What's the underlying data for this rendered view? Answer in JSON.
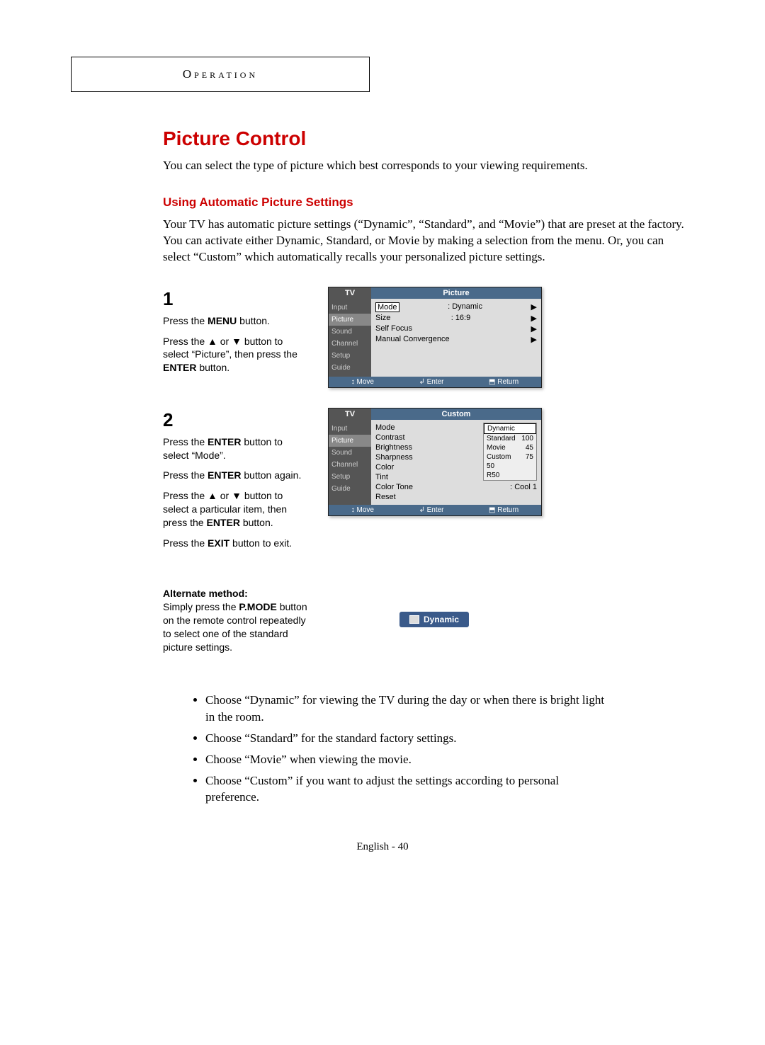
{
  "header": "Operation",
  "title": "Picture Control",
  "intro": "You can select the type of picture which best corresponds to your viewing requirements.",
  "subhead": "Using Automatic Picture Settings",
  "body": "Your TV has automatic picture settings (“Dynamic”, “Standard”, and “Movie”) that are preset at the factory.  You can activate either Dynamic, Standard, or Movie by making a selection from the menu. Or, you can select “Custom” which automatically recalls your personalized picture settings.",
  "step1": {
    "num": "1",
    "line1a": "Press the ",
    "line1b": "MENU",
    "line1c": " button.",
    "line2a": "Press the ▲ or ▼ button to select “Picture”, then press the ",
    "line2b": "ENTER",
    "line2c": " button."
  },
  "step2": {
    "num": "2",
    "line1a": "Press the ",
    "line1b": "ENTER",
    "line1c": " button to select “Mode”.",
    "line2a": "Press the ",
    "line2b": "ENTER",
    "line2c": " button again.",
    "line3a": "Press the ▲ or ▼ button to select a particular item, then press the ",
    "line3b": "ENTER",
    "line3c": " button.",
    "line4a": "Press the ",
    "line4b": "EXIT",
    "line4c": " button to exit."
  },
  "alt": {
    "heading": "Alternate method:",
    "text1": "Simply press the ",
    "text1b": "P.MODE",
    "text2": " button on the remote control repeatedly to select one of the standard picture settings.",
    "badge": "Dynamic"
  },
  "osd1": {
    "tv": "TV",
    "title": "Picture",
    "side": [
      "Input",
      "Picture",
      "Sound",
      "Channel",
      "Setup",
      "Guide"
    ],
    "rows": [
      {
        "label": "Mode",
        "value": ":   Dynamic"
      },
      {
        "label": "Size",
        "value": ":   16:9"
      },
      {
        "label": "Self Focus",
        "value": ""
      },
      {
        "label": "Manual Convergence",
        "value": ""
      }
    ],
    "bottom": [
      "↕ Move",
      "↲ Enter",
      "⬒ Return"
    ]
  },
  "osd2": {
    "tv": "TV",
    "title": "Custom",
    "side": [
      "Input",
      "Picture",
      "Sound",
      "Channel",
      "Setup",
      "Guide"
    ],
    "rows": [
      {
        "label": "Mode",
        "value": ":"
      },
      {
        "label": "Contrast",
        "value": ""
      },
      {
        "label": "Brightness",
        "value": ""
      },
      {
        "label": "Sharpness",
        "value": ""
      },
      {
        "label": "Color",
        "value": ""
      },
      {
        "label": "Tint",
        "value": "G 50"
      },
      {
        "label": "Color Tone",
        "value": ":   Cool 1"
      },
      {
        "label": "Reset",
        "value": ""
      }
    ],
    "submenu": [
      {
        "label": "Dynamic",
        "val": ""
      },
      {
        "label": "Standard",
        "val": "100"
      },
      {
        "label": "Movie",
        "val": "45"
      },
      {
        "label": "Custom",
        "val": "75"
      }
    ],
    "extra_vals": [
      "50",
      "R50"
    ],
    "bottom": [
      "↕ Move",
      "↲ Enter",
      "⬒ Return"
    ]
  },
  "bullets": [
    "Choose “Dynamic” for viewing the TV during the day or when there is bright light in the room.",
    "Choose “Standard” for the standard factory settings.",
    "Choose “Movie” when viewing the movie.",
    "Choose “Custom” if you want to adjust the settings according to personal preference."
  ],
  "footer": "English - 40"
}
